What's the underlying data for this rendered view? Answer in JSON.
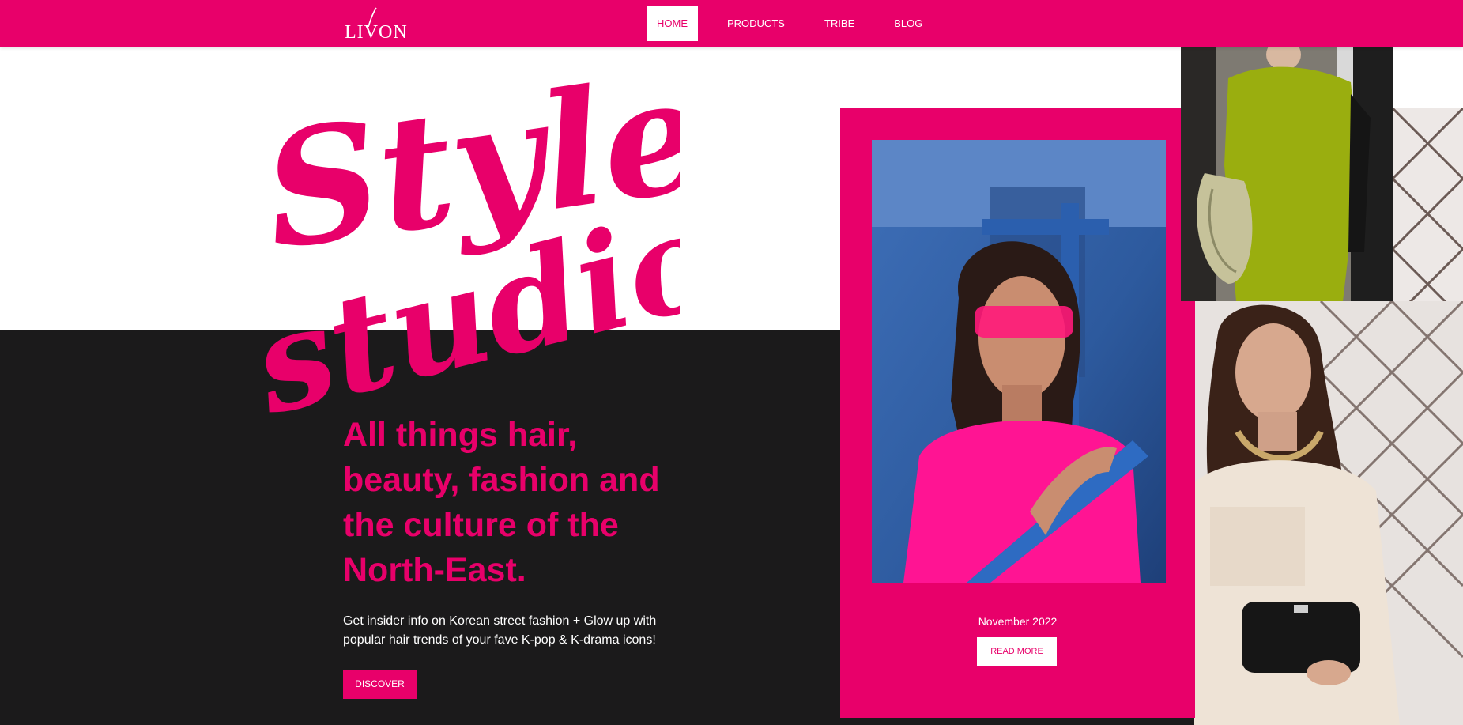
{
  "nav": {
    "logo_text": "LIVON",
    "items": [
      {
        "label": "HOME",
        "active": true
      },
      {
        "label": "PRODUCTS",
        "active": false
      },
      {
        "label": "TRIBE",
        "active": false
      },
      {
        "label": "BLOG",
        "active": false
      }
    ]
  },
  "hero": {
    "script_line1": "Style",
    "script_line2": "studio",
    "headline": "All things hair, beauty, fashion and the culture of the North-East.",
    "subtext": "Get insider info on Korean street fashion + Glow up with popular hair trends of your fave K-pop & K-drama icons!",
    "cta_label": "DISCOVER"
  },
  "feature_card": {
    "date": "November 2022",
    "cta_label": "READ MORE"
  },
  "colors": {
    "brand_pink": "#E8006A",
    "dark_band": "#1B1A1B",
    "white": "#FFFFFF"
  }
}
